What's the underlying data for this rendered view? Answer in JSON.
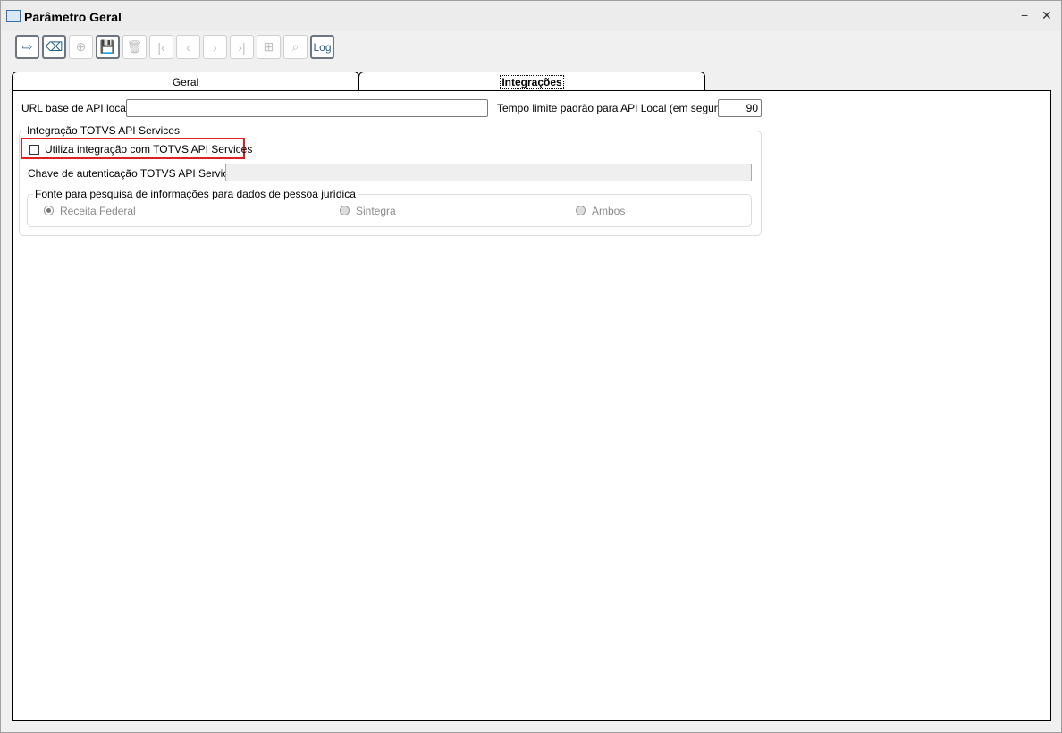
{
  "window": {
    "title": "Parâmetro Geral",
    "minimize": "−",
    "close": "✕"
  },
  "toolbar": [
    {
      "name": "exit",
      "icon": "exit-icon",
      "glyph": "⇨",
      "enabled": true
    },
    {
      "name": "clear",
      "icon": "eraser-icon",
      "glyph": "⌫",
      "enabled": true
    },
    {
      "name": "add",
      "icon": "plus-circle-icon",
      "glyph": "⊕",
      "enabled": false
    },
    {
      "name": "save",
      "icon": "save-icon",
      "glyph": "💾",
      "enabled": true
    },
    {
      "name": "delete",
      "icon": "trash-icon",
      "glyph": "🗑",
      "enabled": false
    },
    {
      "name": "first",
      "icon": "first-icon",
      "glyph": "|‹",
      "enabled": false
    },
    {
      "name": "prev",
      "icon": "prev-icon",
      "glyph": "‹",
      "enabled": false
    },
    {
      "name": "next",
      "icon": "next-icon",
      "glyph": "›",
      "enabled": false
    },
    {
      "name": "last",
      "icon": "last-icon",
      "glyph": "›|",
      "enabled": false
    },
    {
      "name": "grid",
      "icon": "table-icon",
      "glyph": "⊞",
      "enabled": false
    },
    {
      "name": "search",
      "icon": "search-icon",
      "glyph": "⌕",
      "enabled": false
    },
    {
      "name": "log",
      "icon": "log-icon",
      "glyph": "Log",
      "enabled": true
    }
  ],
  "tabs": [
    {
      "label": "Geral"
    },
    {
      "label": "Integrações",
      "active": true
    }
  ],
  "form": {
    "url_label": "URL base de API local:",
    "url_value": "",
    "timeout_label": "Tempo limite padrão para API Local (em segundos):",
    "timeout_value": "90",
    "group_title": "Integração TOTVS API Services",
    "use_integration_label": "Utiliza integração com TOTVS API Services",
    "use_integration_checked": false,
    "key_label": "Chave de autenticação TOTVS API Services:",
    "key_value": "",
    "source_group_title": "Fonte para pesquisa de informações para dados de pessoa jurídica",
    "sources": [
      {
        "label": "Receita Federal",
        "selected": true
      },
      {
        "label": "Sintegra",
        "selected": false
      },
      {
        "label": "Ambos",
        "selected": false
      }
    ]
  },
  "highlight_color": "#e02020"
}
